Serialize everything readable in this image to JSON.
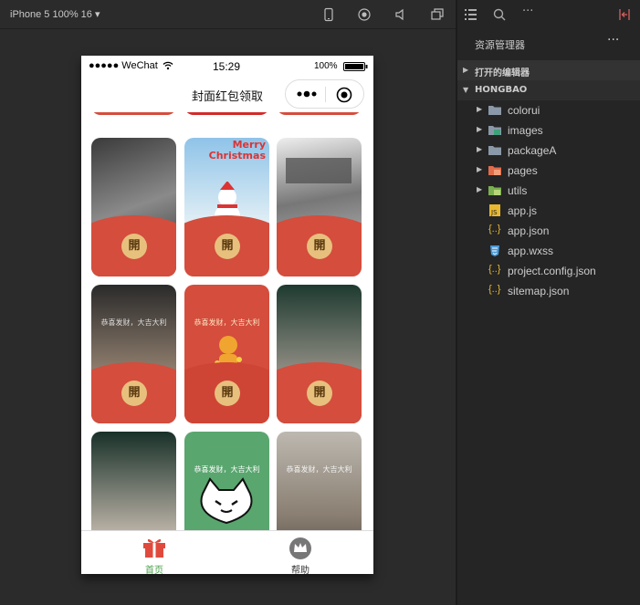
{
  "toolbar": {
    "device_label": "iPhone 5 100% 16 ▾"
  },
  "phone": {
    "status": {
      "carrier": "●●●●● WeChat",
      "time": "15:29",
      "battery": "100%"
    },
    "nav_title": "封面红包领取",
    "cards": [
      {
        "open": "開",
        "caption": ""
      },
      {
        "open": "開",
        "caption": "Merry Christmas"
      },
      {
        "open": "開",
        "caption": ""
      },
      {
        "open": "開",
        "caption": "恭喜发财，大吉大利"
      },
      {
        "open": "開",
        "caption": "恭喜发财，大吉大利"
      },
      {
        "open": "開",
        "caption": ""
      },
      {
        "open": "",
        "caption": ""
      },
      {
        "open": "",
        "caption": "恭喜发财，大吉大利"
      },
      {
        "open": "",
        "caption": "恭喜发财，大吉大利"
      }
    ],
    "tabs": [
      {
        "label": "首页",
        "active": true
      },
      {
        "label": "帮助",
        "active": false
      }
    ]
  },
  "explorer": {
    "title": "资源管理器",
    "open_editors": "打开的编辑器",
    "project": "HONGBAO",
    "items": [
      {
        "name": "colorui",
        "type": "folder"
      },
      {
        "name": "images",
        "type": "folder-images"
      },
      {
        "name": "packageA",
        "type": "folder"
      },
      {
        "name": "pages",
        "type": "folder-pages"
      },
      {
        "name": "utils",
        "type": "folder-utils"
      },
      {
        "name": "app.js",
        "type": "js"
      },
      {
        "name": "app.json",
        "type": "json"
      },
      {
        "name": "app.wxss",
        "type": "css"
      },
      {
        "name": "project.config.json",
        "type": "json"
      },
      {
        "name": "sitemap.json",
        "type": "json"
      }
    ]
  },
  "colors": {
    "accent_red": "#d44d3d",
    "tab_active": "#4ca24c",
    "panel": "#252526"
  }
}
